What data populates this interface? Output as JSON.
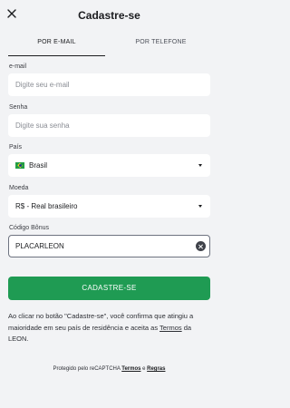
{
  "header": {
    "title": "Cadastre-se",
    "close_icon": "close-icon"
  },
  "tabs": [
    {
      "label": "POR E-MAIL",
      "active": true
    },
    {
      "label": "POR TELEFONE",
      "active": false
    }
  ],
  "form": {
    "email": {
      "label": "e-mail",
      "placeholder": "Digite seu e-mail",
      "value": ""
    },
    "password": {
      "label": "Senha",
      "placeholder": "Digite sua senha",
      "value": ""
    },
    "country": {
      "label": "País",
      "value": "Brasil",
      "flag": "brazil-flag-icon"
    },
    "currency": {
      "label": "Moeda",
      "value": "R$ - Real brasileiro"
    },
    "bonus": {
      "label": "Código Bônus",
      "value": "PLACARLEON"
    }
  },
  "submit_label": "CADASTRE-SE",
  "terms": {
    "before": "Ao clicar no botão \"Cadastre-se\", você confirma que atingiu a maioridade em seu país de residência e aceita as ",
    "link": "Termos",
    "after": " da LEON."
  },
  "recaptcha": {
    "before": "Protegido pelo reCAPTCHA ",
    "link1": "Termos",
    "middle": " e ",
    "link2": "Regras"
  },
  "colors": {
    "accent": "#1f9b53",
    "background": "#f2f3f5",
    "field": "#ffffff"
  }
}
